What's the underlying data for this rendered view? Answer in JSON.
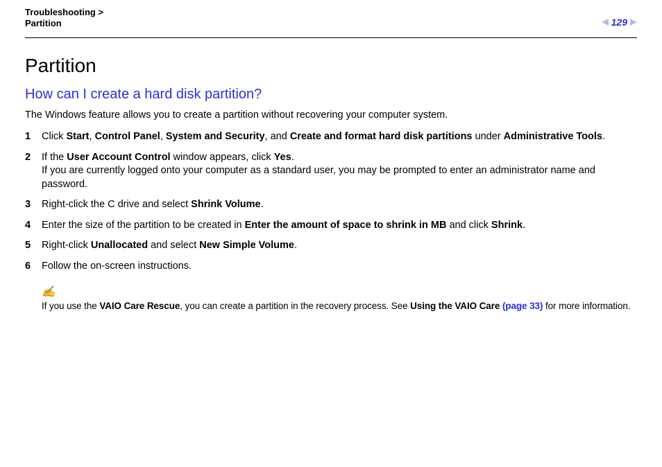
{
  "header": {
    "breadcrumb_line1": "Troubleshooting >",
    "breadcrumb_line2": "Partition",
    "page_number": "129"
  },
  "title": "Partition",
  "subtitle": "How can I create a hard disk partition?",
  "intro": "The Windows feature allows you to create a partition without recovering your computer system.",
  "steps": [
    {
      "num": "1",
      "parts": [
        {
          "t": "Click "
        },
        {
          "t": "Start",
          "b": true
        },
        {
          "t": ", "
        },
        {
          "t": "Control Panel",
          "b": true
        },
        {
          "t": ", "
        },
        {
          "t": "System and Security",
          "b": true
        },
        {
          "t": ", and "
        },
        {
          "t": "Create and format hard disk partitions",
          "b": true
        },
        {
          "t": " under "
        },
        {
          "t": "Administrative Tools",
          "b": true
        },
        {
          "t": "."
        }
      ]
    },
    {
      "num": "2",
      "parts": [
        {
          "t": "If the "
        },
        {
          "t": "User Account Control",
          "b": true
        },
        {
          "t": " window appears, click "
        },
        {
          "t": "Yes",
          "b": true
        },
        {
          "t": "."
        },
        {
          "br": true
        },
        {
          "t": "If you are currently logged onto your computer as a standard user, you may be prompted to enter an administrator name and password."
        }
      ]
    },
    {
      "num": "3",
      "parts": [
        {
          "t": "Right-click the C drive and select "
        },
        {
          "t": "Shrink Volume",
          "b": true
        },
        {
          "t": "."
        }
      ]
    },
    {
      "num": "4",
      "parts": [
        {
          "t": "Enter the size of the partition to be created in "
        },
        {
          "t": "Enter the amount of space to shrink in MB",
          "b": true
        },
        {
          "t": " and click "
        },
        {
          "t": "Shrink",
          "b": true
        },
        {
          "t": "."
        }
      ]
    },
    {
      "num": "5",
      "parts": [
        {
          "t": "Right-click "
        },
        {
          "t": "Unallocated",
          "b": true
        },
        {
          "t": " and select "
        },
        {
          "t": "New Simple Volume",
          "b": true
        },
        {
          "t": "."
        }
      ]
    },
    {
      "num": "6",
      "parts": [
        {
          "t": "Follow the on-screen instructions."
        }
      ]
    }
  ],
  "note": {
    "icon": "✍",
    "parts": [
      {
        "t": "If you use the "
      },
      {
        "t": "VAIO Care Rescue",
        "b": true
      },
      {
        "t": ", you can create a partition in the recovery process. See "
      },
      {
        "t": "Using the VAIO Care ",
        "b": true
      },
      {
        "t": "(page 33)",
        "link": true
      },
      {
        "t": " for more information."
      }
    ]
  }
}
